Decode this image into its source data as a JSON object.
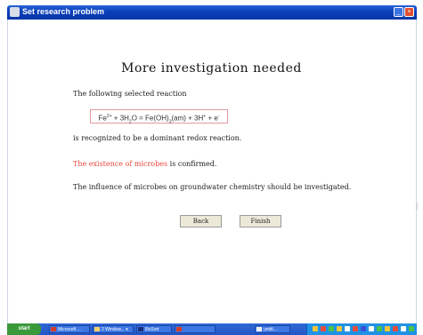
{
  "window": {
    "title": "Set research problem",
    "controls": {
      "minimize": "_",
      "close": "×"
    }
  },
  "content": {
    "heading": "More investigation needed",
    "intro": "The following selected reaction",
    "equation": {
      "p1": "Fe",
      "p1_sup": "2+",
      "p2": " + 3H",
      "p2_sub": "2",
      "p3": "O = Fe(OH)",
      "p3_sub": "3",
      "p4": "(am) + 3H",
      "p4_sup": "+",
      "p5": " + e",
      "p5_sup": "-"
    },
    "recognized": "is recognized to be a dominant redox reaction.",
    "microbes_highlight": "The existence of microbes",
    "microbes_rest": " is confirmed.",
    "influence": "The influence of microbes on groundwater chemistry should be investigated.",
    "back_label": "Back",
    "finish_label": "Finish"
  },
  "taskbar": {
    "start_label": "start",
    "tasks": [
      "Microsoft ...",
      "2 Window... ▾",
      "IlluSort",
      "",
      "untitl..."
    ]
  },
  "colors": {
    "accent": "#0a3fb8",
    "highlight": "#e8453c",
    "taskbar": "#2456c7"
  }
}
